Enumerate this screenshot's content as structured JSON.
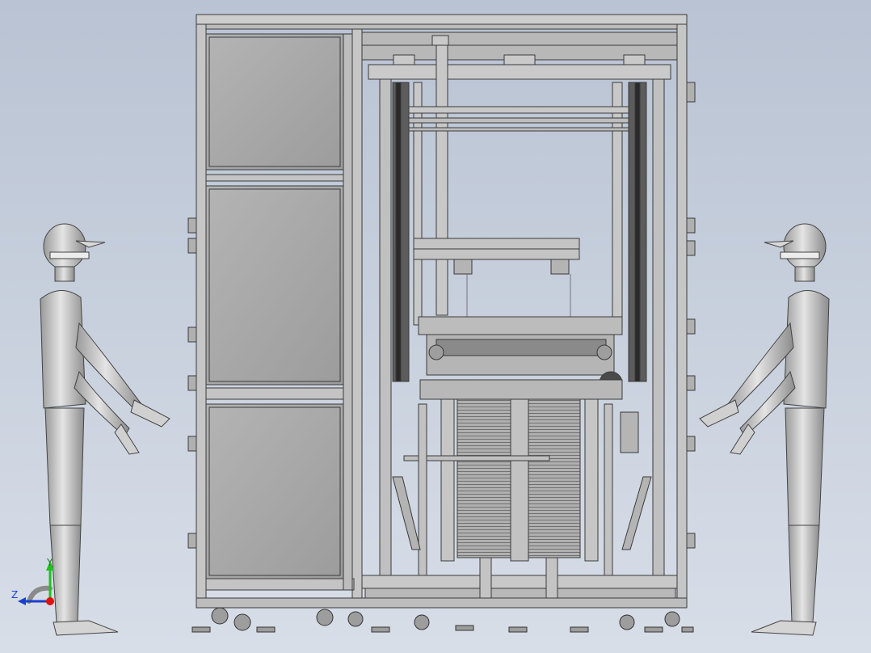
{
  "viewport": {
    "background_top": "#b9c3d3",
    "background_bottom": "#d8dee8",
    "model_fill": "#bfbfbf",
    "model_edge": "#3a3a3a",
    "panel_fill": "#a9a9a9"
  },
  "triad": {
    "y_label": "Y",
    "z_label": "Z",
    "y_color": "#20c020",
    "z_color": "#1b3fd0",
    "x_color": "#e01010"
  },
  "figures": [
    {
      "name": "left-mannequin",
      "facing": "right"
    },
    {
      "name": "right-mannequin",
      "facing": "left"
    }
  ]
}
